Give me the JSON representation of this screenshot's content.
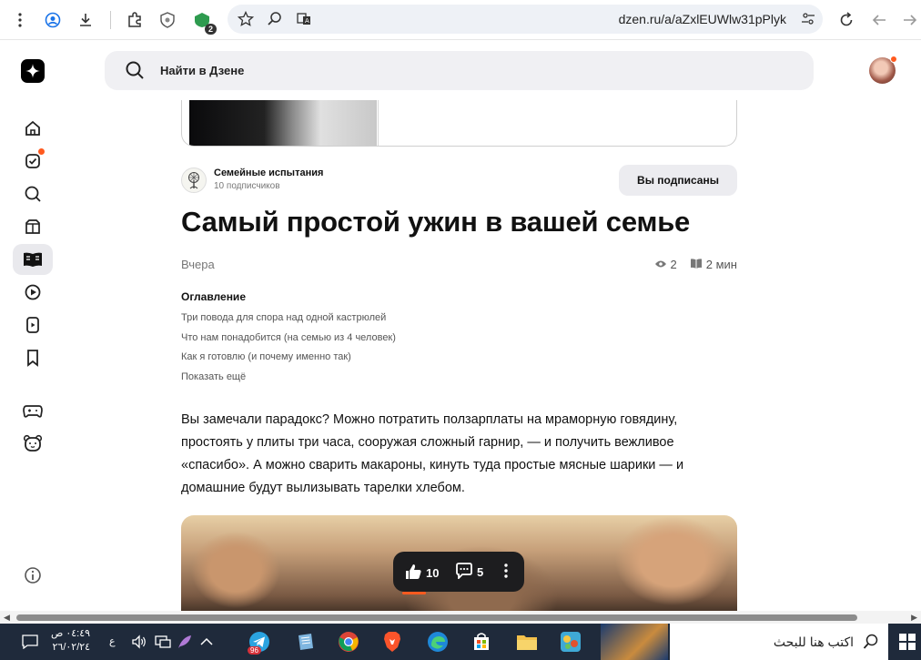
{
  "browser": {
    "url": "dzen.ru/a/aZxlEUWlw31pPlyk",
    "extension_badge": "2",
    "icons": [
      "more-vert-icon",
      "account-icon",
      "download-icon",
      "extensions-icon",
      "shield-icon",
      "extension-badge-icon",
      "star-icon",
      "zoom-icon",
      "translate-icon",
      "tune-icon",
      "reload-icon",
      "back-icon",
      "forward-icon"
    ]
  },
  "header": {
    "search_placeholder": "Найти в Дзене"
  },
  "sidebar": {
    "items": [
      "home-icon",
      "subscriptions-icon",
      "search-icon",
      "shop-icon",
      "articles-icon",
      "video-icon",
      "shorts-icon",
      "bookmarks-icon",
      "games-icon",
      "kids-icon",
      "info-icon"
    ]
  },
  "channel": {
    "name": "Семейные испытания",
    "subscribers": "10 подписчиков",
    "subscribe_button": "Вы подписаны"
  },
  "article": {
    "title": "Самый простой ужин в вашей семье",
    "date": "Вчера",
    "views": "2",
    "read_time": "2 мин",
    "toc_heading": "Оглавление",
    "toc": [
      "Три повода для спора над одной кастрюлей",
      "Что нам понадобится (на семью из 4 человек)",
      "Как я готовлю (и почему именно так)"
    ],
    "toc_more": "Показать ещё",
    "paragraph": "Вы замечали парадокс? Можно потратить ползарплаты на мраморную говядину, простоять у плиты три часа, сооружая сложный гарнир, — и получить вежливое «спасибо». А можно сварить макароны, кинуть туда простые мясные шарики — и домашние будут вылизывать тарелки хлебом."
  },
  "reactions": {
    "likes": "10",
    "comments": "5"
  },
  "taskbar": {
    "search_text": "اكتب هنا للبحث",
    "time": "٠٤:٤٩ ص",
    "date": "٢٦/٠٢/٢٤",
    "lang": "ع",
    "telegram_badge": "96"
  }
}
